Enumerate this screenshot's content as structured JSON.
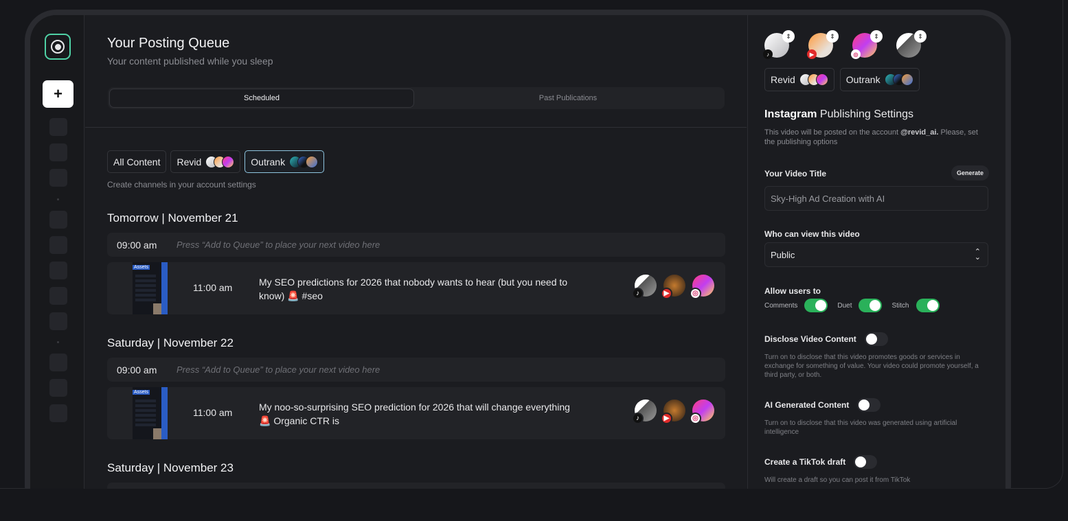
{
  "sidebar": {
    "add_label": "+"
  },
  "header": {
    "title": "Your Posting Queue",
    "subtitle": "Your content published while you sleep"
  },
  "tabs": [
    {
      "label": "Scheduled"
    },
    {
      "label": "Past Publications"
    }
  ],
  "filters": {
    "chips": [
      {
        "label": "All Content"
      },
      {
        "label": "Revid"
      },
      {
        "label": "Outrank"
      }
    ],
    "note": "Create channels in your account settings"
  },
  "queue": {
    "days": [
      {
        "heading": "Tomorrow | November 21",
        "empty_slot": {
          "time": "09:00 am",
          "hint": "Press “Add to Queue” to place your next video here"
        },
        "post": {
          "time": "11:00 am",
          "thumb_tag": "Assets",
          "title": "My SEO predictions for 2026 that nobody wants to hear (but you need to know) 🚨 #seo"
        }
      },
      {
        "heading": "Saturday | November 22",
        "empty_slot": {
          "time": "09:00 am",
          "hint": "Press “Add to Queue” to place your next video here"
        },
        "post": {
          "time": "11:00 am",
          "thumb_tag": "Assets",
          "title": "My noo-so-surprising SEO prediction for 2026 that will change everything 🚨 Organic CTR is"
        }
      },
      {
        "heading": "Saturday | November 23"
      }
    ]
  },
  "panel": {
    "channels": [
      {
        "label": "Revid"
      },
      {
        "label": "Outrank"
      }
    ],
    "title_strong": "Instagram",
    "title_rest": " Publishing Settings",
    "desc_pre": "This video will be posted on the account ",
    "desc_account": "@revid_ai.",
    "desc_post": " Please, set the publishing options",
    "video_title_label": "Your Video Title",
    "generate_label": "Generate",
    "video_title_value": "Sky-High Ad Creation with AI",
    "who_label": "Who can view this video",
    "who_value": "Public",
    "allow_label": "Allow users to",
    "allow": [
      {
        "label": "Comments",
        "on": true
      },
      {
        "label": "Duet",
        "on": true
      },
      {
        "label": "Stitch",
        "on": true
      }
    ],
    "disclose_label": "Disclose Video Content",
    "disclose_desc": "Turn on to disclose that this video promotes goods or services in exchange for something of value. Your video could promote yourself, a third party, or both.",
    "ai_label": "AI Generated Content",
    "ai_desc": "Turn on to disclose that this video was generated using artificial intelligence",
    "draft_label": "Create a TikTok draft",
    "draft_desc": "Will create a draft so you can post it from TikTok"
  },
  "colors": {
    "accent_green": "#2ab15a",
    "logo_green": "#4fd1a5",
    "active_chip_border": "#8ec5e0"
  },
  "icons": [
    "logo-icon",
    "plus-icon",
    "tiktok-icon",
    "youtube-icon",
    "instagram-icon",
    "chevron-updown-icon"
  ]
}
